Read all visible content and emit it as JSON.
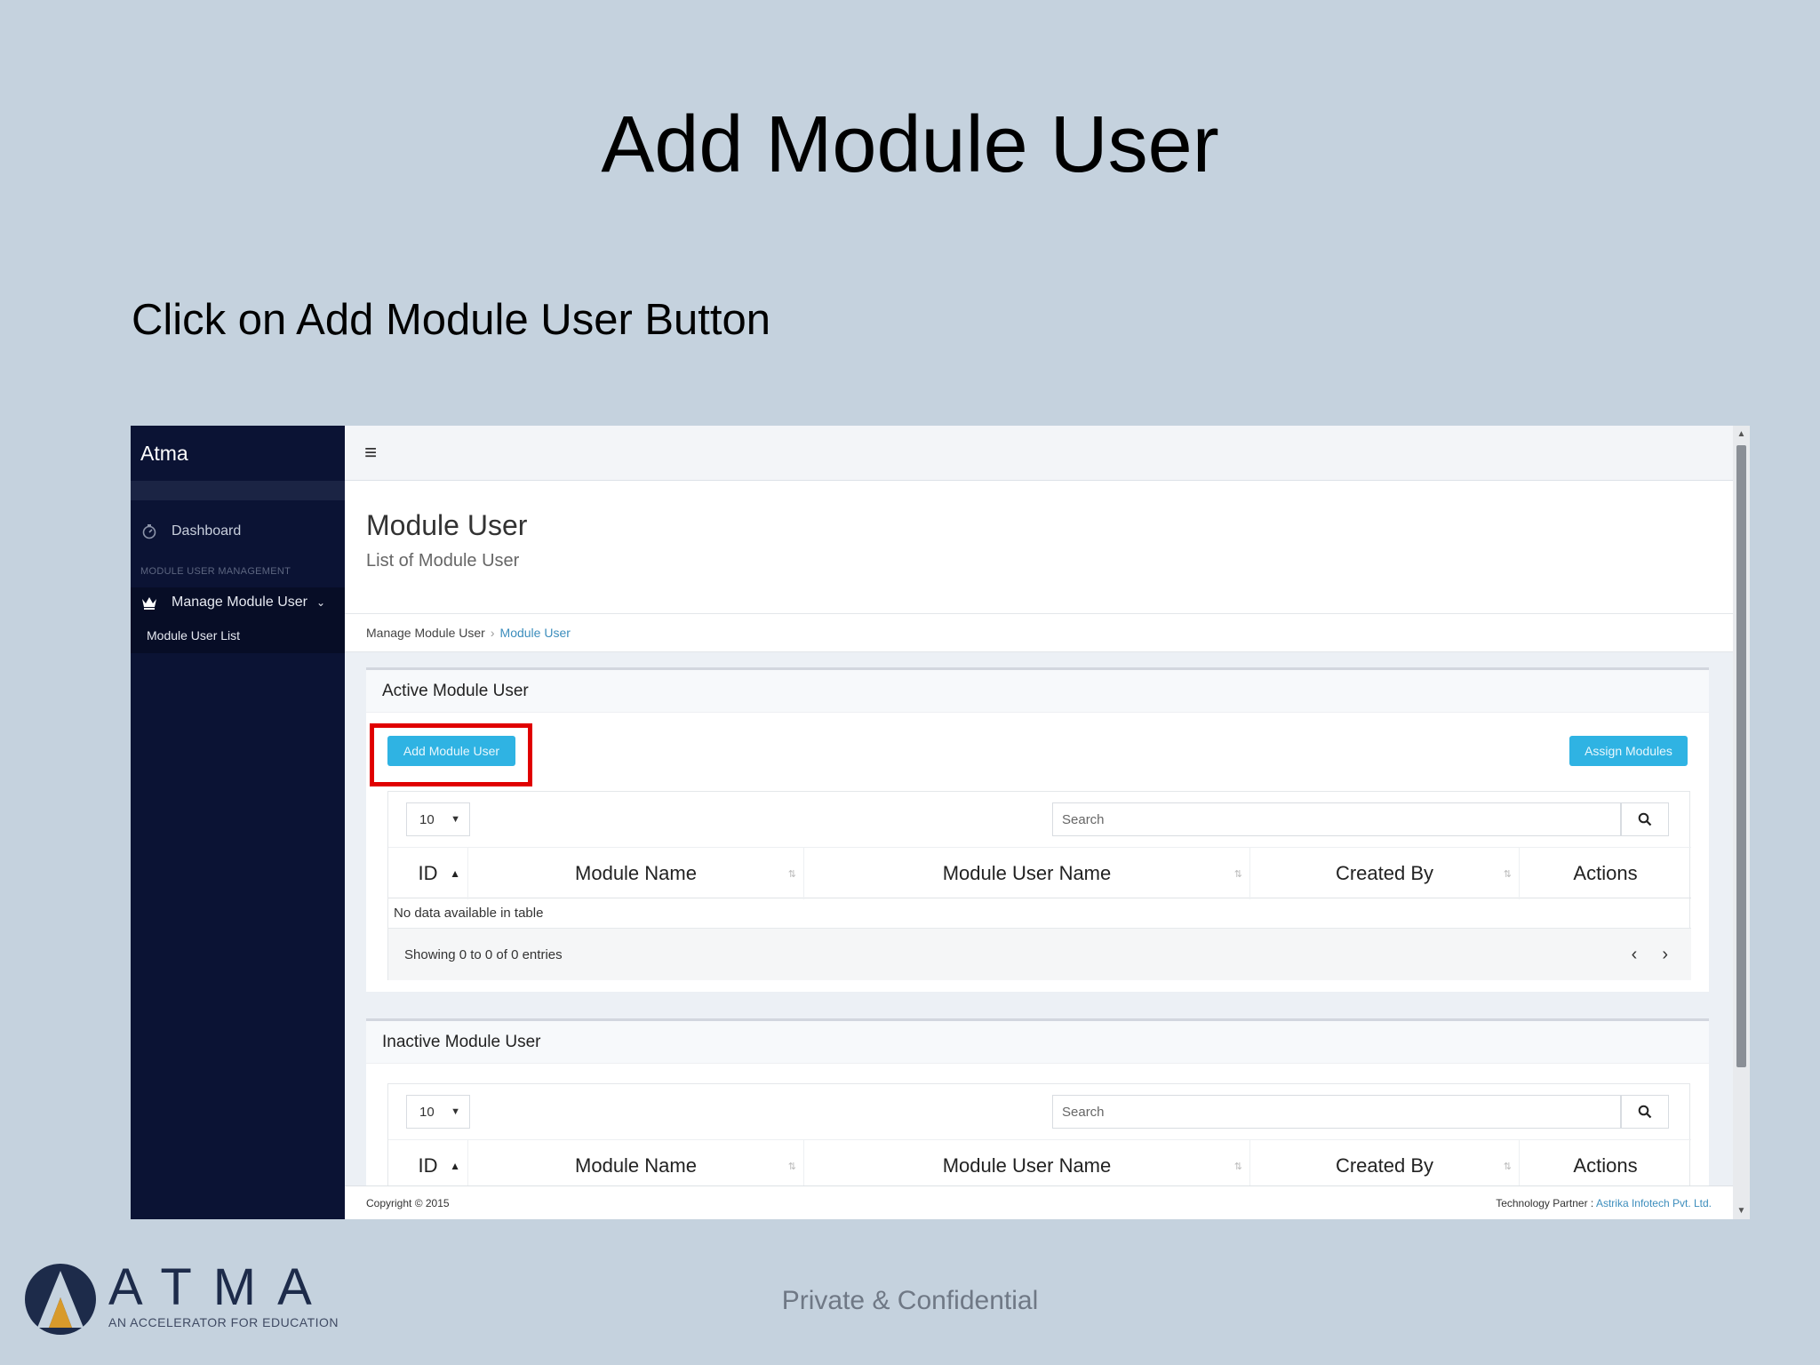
{
  "slide": {
    "title": "Add Module User",
    "instruction": "Click on Add Module User Button",
    "confidential": "Private & Confidential",
    "logo_word": "ATMA",
    "logo_tagline": "AN ACCELERATOR FOR EDUCATION"
  },
  "app": {
    "brand": "Atma",
    "sidebar": {
      "dashboard": "Dashboard",
      "section_header": "MODULE USER MANAGEMENT",
      "manage_label": "Manage Module User",
      "sub_item": "Module User List"
    },
    "topbar": {
      "menu_icon": "hamburger-icon"
    },
    "header": {
      "title": "Module User",
      "subtitle": "List of Module User"
    },
    "breadcrumb": {
      "parent": "Manage Module User",
      "current": "Module User"
    },
    "active_box": {
      "title": "Active Module User",
      "add_button": "Add Module User",
      "assign_button": "Assign Modules",
      "page_length": "10",
      "search_placeholder": "Search",
      "columns": [
        "ID",
        "Module Name",
        "Module User Name",
        "Created By",
        "Actions"
      ],
      "empty_text": "No data available in table",
      "info_text": "Showing 0 to 0 of 0 entries",
      "prev": "‹",
      "next": "›"
    },
    "inactive_box": {
      "title": "Inactive Module User",
      "page_length": "10",
      "search_placeholder": "Search",
      "columns": [
        "ID",
        "Module Name",
        "Module User Name",
        "Created By",
        "Actions"
      ]
    },
    "footer": {
      "copyright": "Copyright © 2015",
      "partner_label": "Technology Partner :",
      "partner_name": "Astrika Infotech Pvt. Ltd."
    }
  },
  "colors": {
    "slide_bg": "#c5d2de",
    "sidebar_bg": "#0b1334",
    "button_bg": "#2fb3e3",
    "highlight_border": "#e00000",
    "link": "#3c8dbc"
  }
}
